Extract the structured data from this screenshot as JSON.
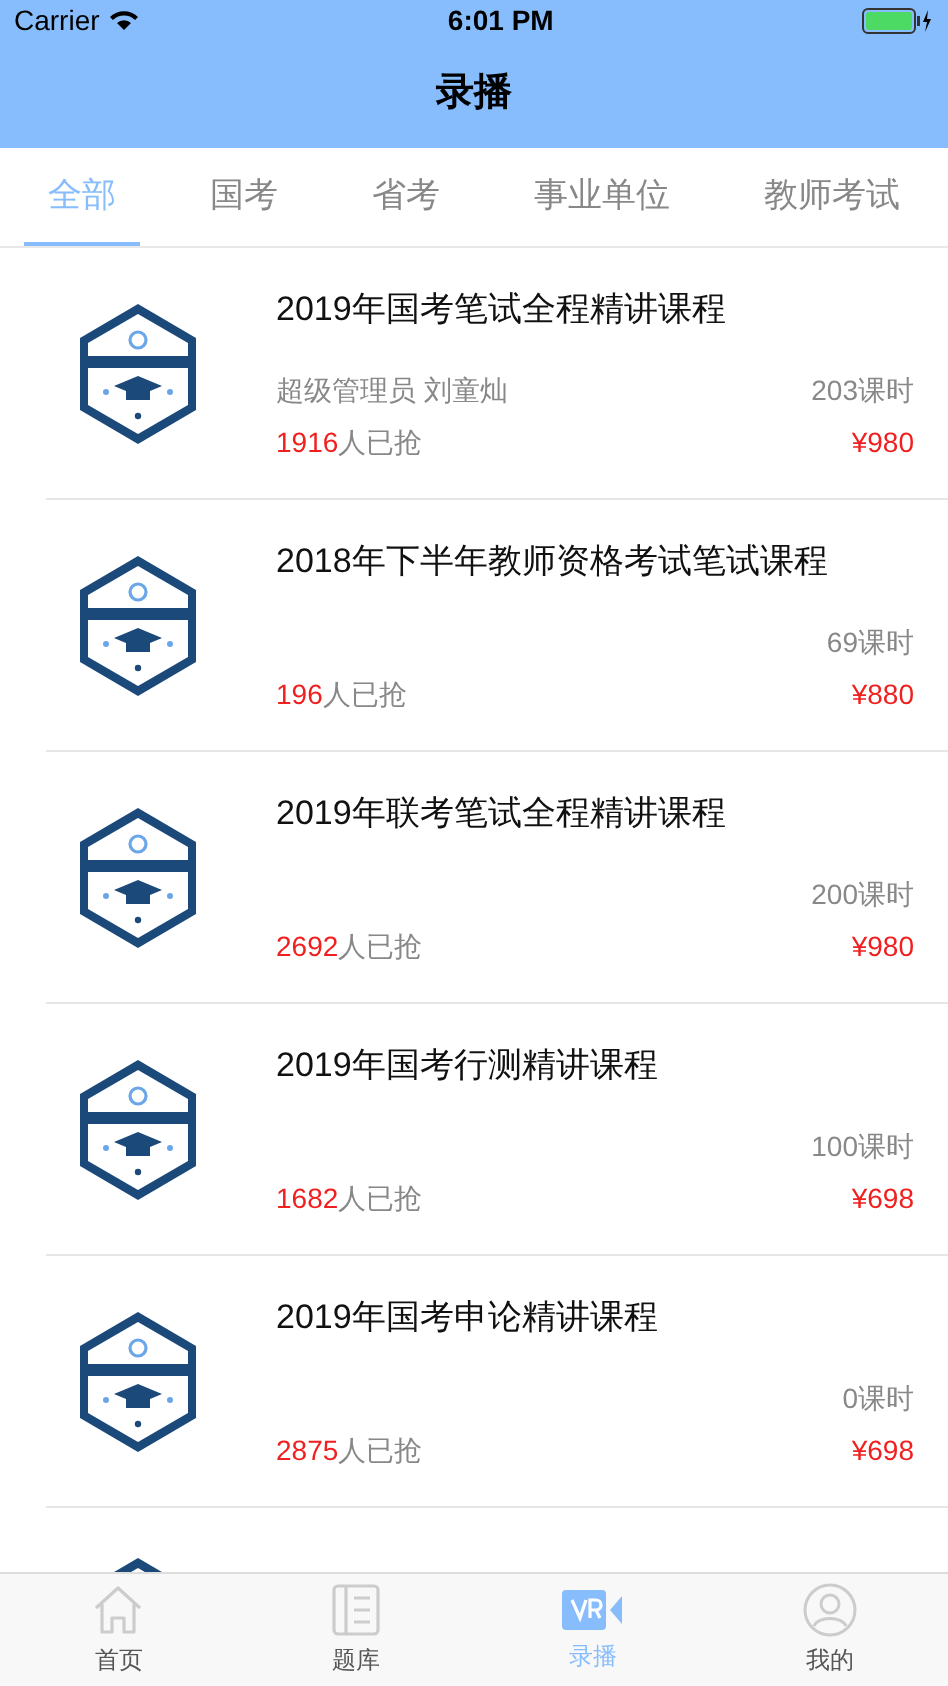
{
  "status_bar": {
    "carrier": "Carrier",
    "time": "6:01 PM"
  },
  "nav": {
    "title": "录播"
  },
  "tabs": [
    {
      "label": "全部",
      "selected": true
    },
    {
      "label": "国考",
      "selected": false
    },
    {
      "label": "省考",
      "selected": false
    },
    {
      "label": "事业单位",
      "selected": false
    },
    {
      "label": "教师考试",
      "selected": false
    }
  ],
  "courses": [
    {
      "title": "2019年国考笔试全程精讲课程",
      "teacher": "超级管理员 刘童灿",
      "count": "1916",
      "count_suffix": "人已抢",
      "lessons": "203课时",
      "price": "¥980"
    },
    {
      "title": "2018年下半年教师资格考试笔试课程",
      "count": "196",
      "count_suffix": "人已抢",
      "lessons": "69课时",
      "price": "¥880"
    },
    {
      "title": "2019年联考笔试全程精讲课程",
      "count": "2692",
      "count_suffix": "人已抢",
      "lessons": "200课时",
      "price": "¥980"
    },
    {
      "title": "2019年国考行测精讲课程",
      "count": "1682",
      "count_suffix": "人已抢",
      "lessons": "100课时",
      "price": "¥698"
    },
    {
      "title": "2019年国考申论精讲课程",
      "count": "2875",
      "count_suffix": "人已抢",
      "lessons": "0课时",
      "price": "¥698"
    },
    {
      "kind": "partial"
    }
  ],
  "tab_bar": [
    {
      "label": "首页",
      "kind": "home",
      "selected": false
    },
    {
      "label": "题库",
      "kind": "bank",
      "selected": false
    },
    {
      "label": "录播",
      "kind": "video",
      "selected": true
    },
    {
      "label": "我的",
      "kind": "profile",
      "selected": false
    }
  ]
}
